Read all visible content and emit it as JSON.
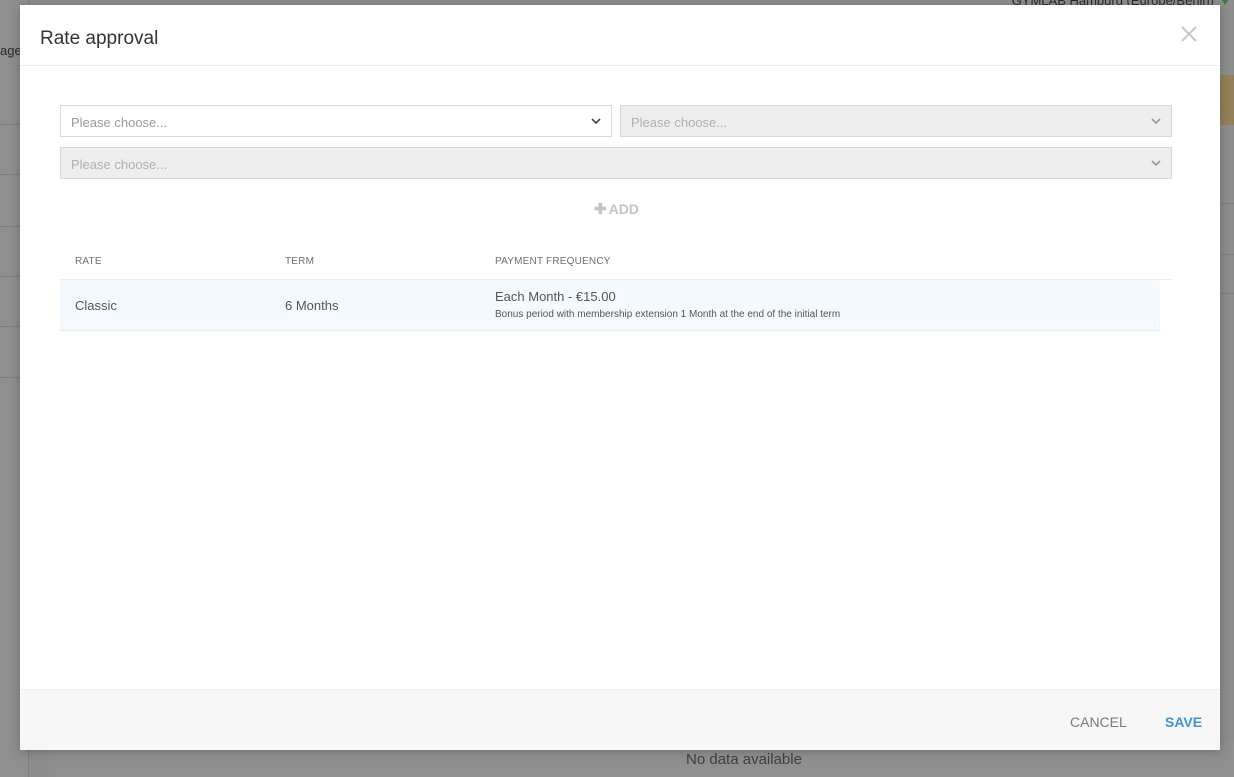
{
  "background": {
    "location_text": "GYMLAB Hamburg (Europe/Berlin)",
    "left_text": "age",
    "no_data_text": "No data available"
  },
  "modal": {
    "title": "Rate approval",
    "selects": [
      {
        "placeholder": "Please choose..."
      },
      {
        "placeholder": "Please choose..."
      },
      {
        "placeholder": "Please choose..."
      }
    ],
    "add_label": "ADD",
    "table": {
      "headers": [
        "RATE",
        "TERM",
        "PAYMENT FREQUENCY"
      ],
      "rows": [
        {
          "rate": "Classic",
          "term": "6 Months",
          "payment": "Each Month - €15.00",
          "payment_note": "Bonus period with membership extension 1 Month at the end of the initial term"
        }
      ]
    },
    "footer": {
      "cancel_label": "CANCEL",
      "save_label": "SAVE"
    }
  },
  "colors": {
    "accent": "#3b96d1",
    "row_highlight": "#f3f9fd"
  },
  "icons": [
    "close-icon",
    "chevron-down-icon",
    "plus-icon"
  ]
}
